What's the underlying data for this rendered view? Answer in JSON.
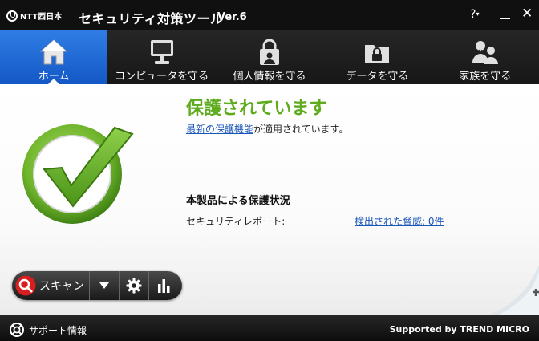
{
  "window": {
    "brand_text": "NTT西日本",
    "title": "セキュリティ対策ツール",
    "version": "Ver.6",
    "help_label": "?",
    "close_symbol": "✕"
  },
  "nav": {
    "items": [
      {
        "label": "ホーム",
        "icon": "home-icon",
        "active": true
      },
      {
        "label": "コンピュータを守る",
        "icon": "monitor-icon",
        "active": false
      },
      {
        "label": "個人情報を守る",
        "icon": "lock-person-icon",
        "active": false
      },
      {
        "label": "データを守る",
        "icon": "folder-lock-icon",
        "active": false
      },
      {
        "label": "家族を守る",
        "icon": "family-icon",
        "active": false
      }
    ]
  },
  "status": {
    "title": "保護されています",
    "link_text": "最新の保護機能",
    "line_suffix": "が適用されています。"
  },
  "protection": {
    "title": "本製品による保護状況",
    "label": "セキュリティレポート:",
    "link": "検出された脅威: 0件"
  },
  "toolbar": {
    "scan_label": "スキャン"
  },
  "footer": {
    "support": "サポート情報",
    "brand": "Supported by TREND MICRO"
  },
  "colors": {
    "accent": "#1a63d4",
    "status_green": "#5eab1e",
    "link": "#1a55b8"
  }
}
